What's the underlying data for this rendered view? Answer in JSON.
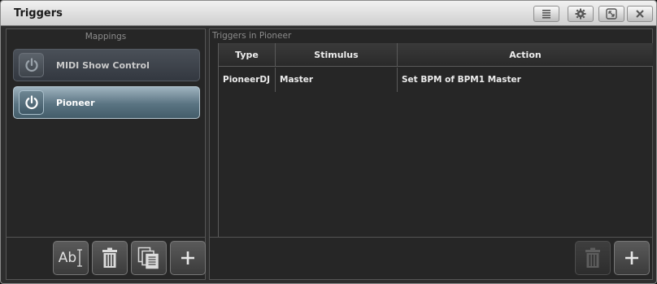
{
  "window": {
    "title": "Triggers"
  },
  "titlebar_buttons": [
    "menu-icon",
    "gear-icon",
    "fullscreen-icon",
    "close-icon"
  ],
  "mappings": {
    "header": "Mappings",
    "items": [
      {
        "label": "MIDI Show Control",
        "selected": false,
        "icon": "power-icon"
      },
      {
        "label": "Pioneer",
        "selected": true,
        "icon": "power-icon"
      }
    ],
    "footer_buttons": {
      "rename_label": "Ab",
      "delete_icon": "trash-icon",
      "copy_icon": "copy-icon",
      "add_label": "+"
    }
  },
  "triggers": {
    "header": "Triggers in Pioneer",
    "columns": [
      "Type",
      "Stimulus",
      "Action"
    ],
    "rows": [
      [
        "PioneerDJ",
        "Master",
        "Set BPM of BPM1 Master"
      ]
    ],
    "footer_buttons": {
      "delete_icon": "trash-icon",
      "delete_enabled": false,
      "add_label": "+"
    }
  },
  "colors": {
    "selected_item": "#5a7482",
    "panel_bg": "#262626",
    "titlebar": "#dcdcdc"
  }
}
